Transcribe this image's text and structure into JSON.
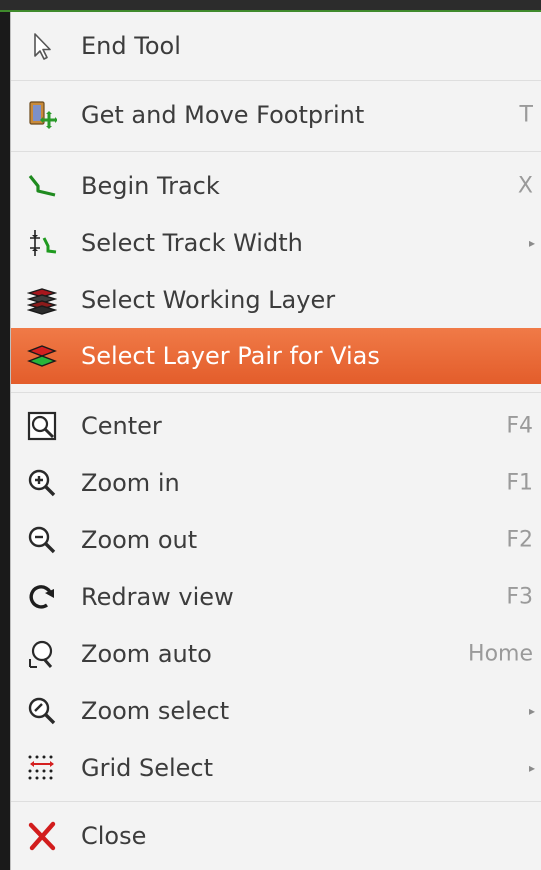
{
  "menu": {
    "items": [
      {
        "label": "End Tool",
        "shortcut": "",
        "icon": "cursor-arrow-icon"
      },
      {
        "label": "Get and Move Footprint",
        "shortcut": "T",
        "icon": "move-footprint-icon"
      },
      {
        "label": "Begin Track",
        "shortcut": "X",
        "icon": "track-icon"
      },
      {
        "label": "Select Track Width",
        "shortcut": "",
        "submenu": true,
        "icon": "track-width-icon"
      },
      {
        "label": "Select Working Layer",
        "shortcut": "",
        "icon": "layers-icon"
      },
      {
        "label": "Select Layer Pair for Vias",
        "shortcut": "",
        "highlighted": true,
        "icon": "layer-pair-icon"
      },
      {
        "label": "Center",
        "shortcut": "F4",
        "icon": "center-icon"
      },
      {
        "label": "Zoom in",
        "shortcut": "F1",
        "icon": "zoom-in-icon"
      },
      {
        "label": "Zoom out",
        "shortcut": "F2",
        "icon": "zoom-out-icon"
      },
      {
        "label": "Redraw view",
        "shortcut": "F3",
        "icon": "redraw-icon"
      },
      {
        "label": "Zoom auto",
        "shortcut": "Home",
        "icon": "zoom-auto-icon"
      },
      {
        "label": "Zoom select",
        "shortcut": "",
        "submenu": true,
        "icon": "zoom-select-icon"
      },
      {
        "label": "Grid Select",
        "shortcut": "",
        "submenu": true,
        "icon": "grid-icon"
      },
      {
        "label": "Close",
        "shortcut": "",
        "icon": "close-icon"
      }
    ],
    "submenu_arrow": "▸",
    "colors": {
      "highlight": "#e8672f",
      "menu_background": "#f3f3f3",
      "label_text": "#3c3c3c",
      "shortcut_text": "#9a9a9a"
    }
  }
}
